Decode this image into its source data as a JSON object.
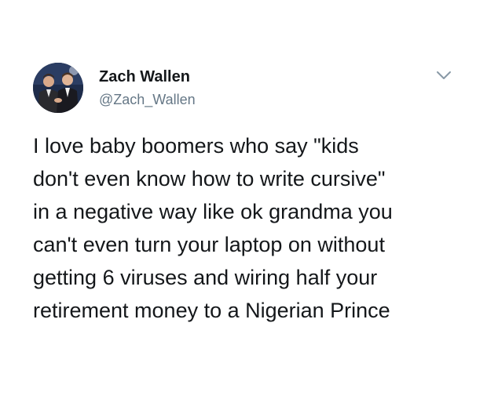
{
  "tweet": {
    "author": {
      "name": "Zach Wallen",
      "handle": "@Zach_Wallen",
      "avatar_icon": "profile-photo"
    },
    "menu_icon": "chevron-down-icon",
    "text_lines": [
      "I love baby boomers who say \"kids",
      "don't even know how to write cursive\"",
      "in a negative way like ok grandma you",
      "can't even turn your laptop on without",
      "getting 6 viruses and wiring half your",
      "retirement money to a Nigerian Prince"
    ]
  },
  "colors": {
    "text": "#14171a",
    "secondary_text": "#657786",
    "background": "#ffffff"
  }
}
